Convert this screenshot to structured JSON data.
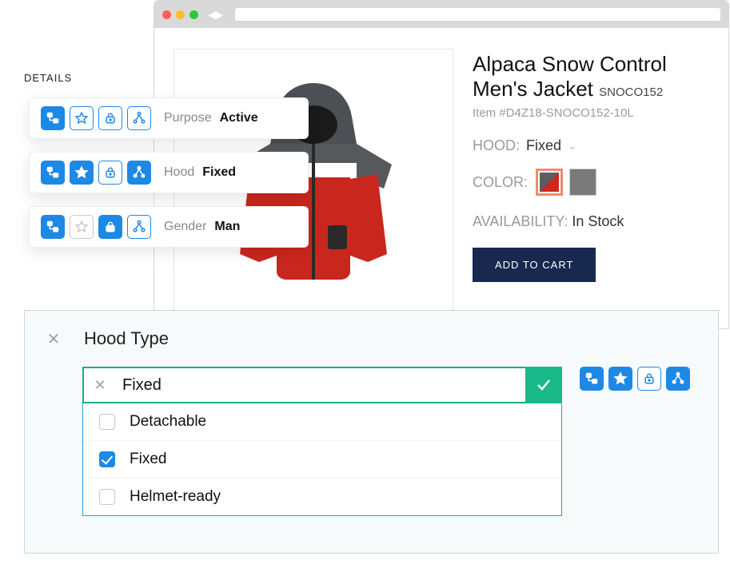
{
  "details": {
    "heading": "DETAILS",
    "rows": [
      {
        "label": "Purpose",
        "value": "Active",
        "icons": {
          "tree": "solid",
          "star": "outline",
          "lock": "outline",
          "share": "outline"
        }
      },
      {
        "label": "Hood",
        "value": "Fixed",
        "icons": {
          "tree": "solid",
          "star": "solid",
          "lock": "outline",
          "share": "solid"
        }
      },
      {
        "label": "Gender",
        "value": "Man",
        "icons": {
          "tree": "solid",
          "star": "grey",
          "lock": "solid",
          "share": "outline"
        }
      }
    ]
  },
  "product": {
    "title_line1": "Alpaca Snow Control",
    "title_line2": "Men's Jacket",
    "sku_inline": "SNOCO152",
    "item_number": "Item #D4Z18-SNOCO152-10L",
    "hood_label": "HOOD:",
    "hood_value": "Fixed",
    "color_label": "COLOR:",
    "swatches": [
      {
        "name": "red-grey",
        "selected": true,
        "c1": "#5a5e60",
        "c2": "#d0261d"
      },
      {
        "name": "grey",
        "selected": false,
        "c1": "#7a7a7a",
        "c2": "#7a7a7a"
      }
    ],
    "availability_label": "AVAILABILITY:",
    "availability_value": "In Stock",
    "add_to_cart": "ADD TO CART"
  },
  "editor": {
    "title": "Hood Type",
    "input_value": "Fixed",
    "options": [
      {
        "label": "Detachable",
        "checked": false
      },
      {
        "label": "Fixed",
        "checked": true
      },
      {
        "label": "Helmet-ready",
        "checked": false
      }
    ],
    "toolbar_icons": {
      "tree": "solid",
      "star": "solid",
      "lock": "outline",
      "share": "solid"
    }
  }
}
